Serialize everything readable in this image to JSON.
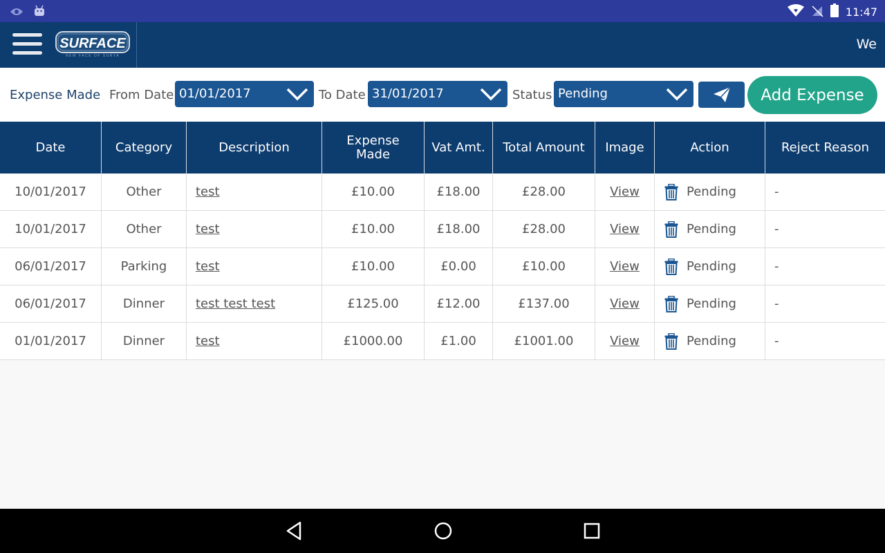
{
  "status_bar": {
    "time": "11:47"
  },
  "header": {
    "logo_text": "SURFACE",
    "logo_tagline": "NEW FACE OF SURYA",
    "welcome": "We"
  },
  "filters": {
    "expense_made_label": "Expense Made",
    "from_label": "From Date",
    "from_value": "01/01/2017",
    "to_label": "To Date",
    "to_value": "31/01/2017",
    "status_label": "Status",
    "status_value": "Pending",
    "add_label": "Add Expense"
  },
  "colors": {
    "header": "#0d3c6e",
    "status_bar": "#2c3b9c",
    "accent": "#21a48a",
    "select": "#1b5592"
  },
  "table": {
    "headers": [
      "Date",
      "Category",
      "Description",
      "Expense Made",
      "Vat Amt.",
      "Total Amount",
      "Image",
      "Action",
      "Reject Reason"
    ],
    "rows": [
      {
        "date": "10/01/2017",
        "category": "Other",
        "description": "test",
        "expense": "£10.00",
        "vat": "£18.00",
        "total": "£28.00",
        "image": "View",
        "status": "Pending",
        "reason": "-"
      },
      {
        "date": "10/01/2017",
        "category": "Other",
        "description": "test",
        "expense": "£10.00",
        "vat": "£18.00",
        "total": "£28.00",
        "image": "View",
        "status": "Pending",
        "reason": "-"
      },
      {
        "date": "06/01/2017",
        "category": "Parking",
        "description": "test",
        "expense": "£10.00",
        "vat": "£0.00",
        "total": "£10.00",
        "image": "View",
        "status": "Pending",
        "reason": "-"
      },
      {
        "date": "06/01/2017",
        "category": "Dinner",
        "description": "test test test",
        "expense": "£125.00",
        "vat": "£12.00",
        "total": "£137.00",
        "image": "View",
        "status": "Pending",
        "reason": "-"
      },
      {
        "date": "01/01/2017",
        "category": "Dinner",
        "description": "test",
        "expense": "£1000.00",
        "vat": "£1.00",
        "total": "£1001.00",
        "image": "View",
        "status": "Pending",
        "reason": "-"
      }
    ]
  }
}
